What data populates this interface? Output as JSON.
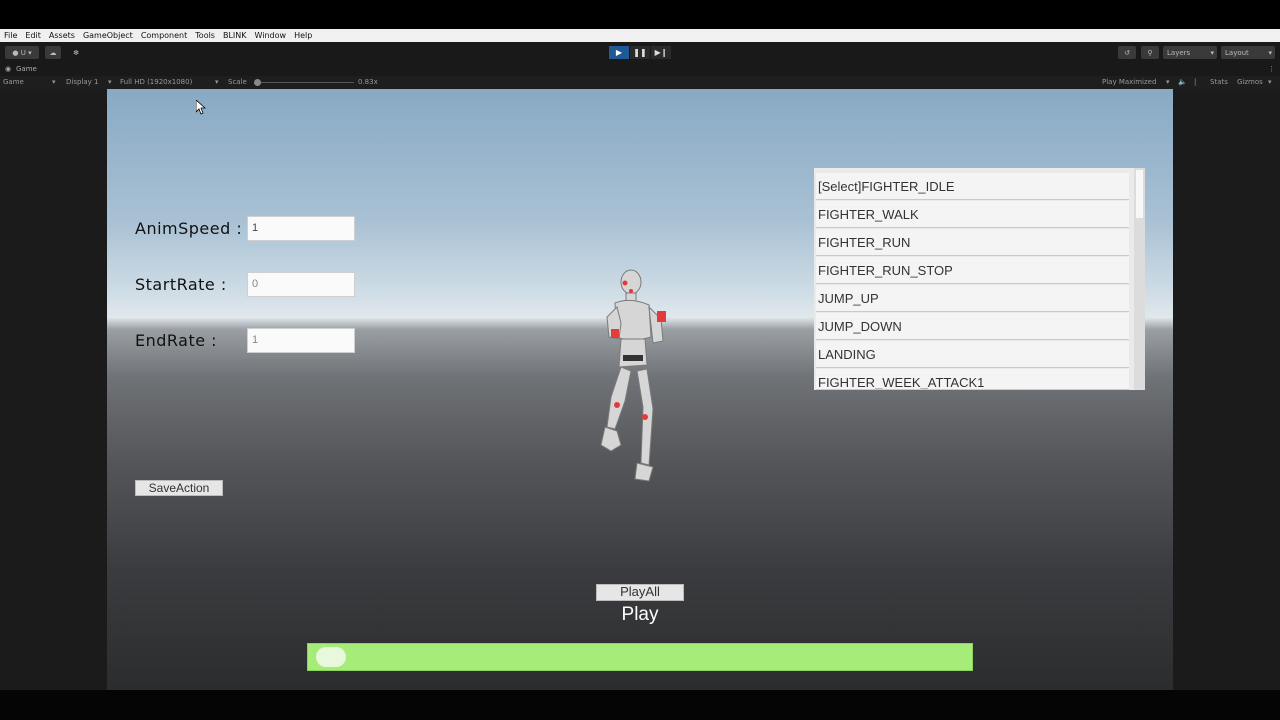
{
  "menu": {
    "items": [
      "File",
      "Edit",
      "Assets",
      "GameObject",
      "Component",
      "Tools",
      "BLINK",
      "Window",
      "Help"
    ]
  },
  "toolbar": {
    "account": "U",
    "layers_label": "Layers",
    "layout_label": "Layout"
  },
  "game_view": {
    "tab_label": "Game",
    "view_select": "Game",
    "display": "Display 1",
    "resolution": "Full HD (1920x1080)",
    "scale_label": "Scale",
    "scale_value": "0.83x",
    "play_mode": "Play Maximized",
    "stats": "Stats",
    "gizmos": "Gizmos"
  },
  "form": {
    "anim_speed_label": "AnimSpeed :",
    "anim_speed_value": "1",
    "start_rate_label": "StartRate :",
    "start_rate_value": "0",
    "end_rate_label": "EndRate :",
    "end_rate_value": "1",
    "save_button": "SaveAction"
  },
  "anim_list": {
    "items": [
      "[Select]FIGHTER_IDLE",
      "FIGHTER_WALK",
      "FIGHTER_RUN",
      "FIGHTER_RUN_STOP",
      "JUMP_UP",
      "JUMP_DOWN",
      "LANDING",
      "FIGHTER_WEEK_ATTACK1"
    ]
  },
  "playback": {
    "play_all_button": "PlayAll",
    "play_label": "Play",
    "progress": 0.02
  },
  "colors": {
    "progress_fill": "#a6ec78",
    "play_button_active": "#1f5a96"
  }
}
